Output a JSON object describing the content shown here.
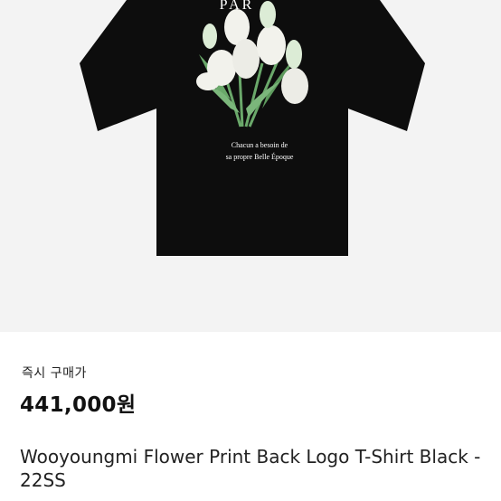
{
  "product": {
    "image_label": "PAR",
    "print_text_line1": "Chacun a besoin de",
    "print_text_line2": "sa propre Belle Époque",
    "buy_type": "즉시 구매가",
    "price": "441,000원",
    "title": "Wooyoungmi Flower Print Back Logo T-Shirt Black - 22SS"
  },
  "colors": {
    "shirt": "#0d0d0d",
    "background": "#f3f3f3",
    "leaf": "#6aa86a",
    "petal": "#f2f2ec"
  }
}
